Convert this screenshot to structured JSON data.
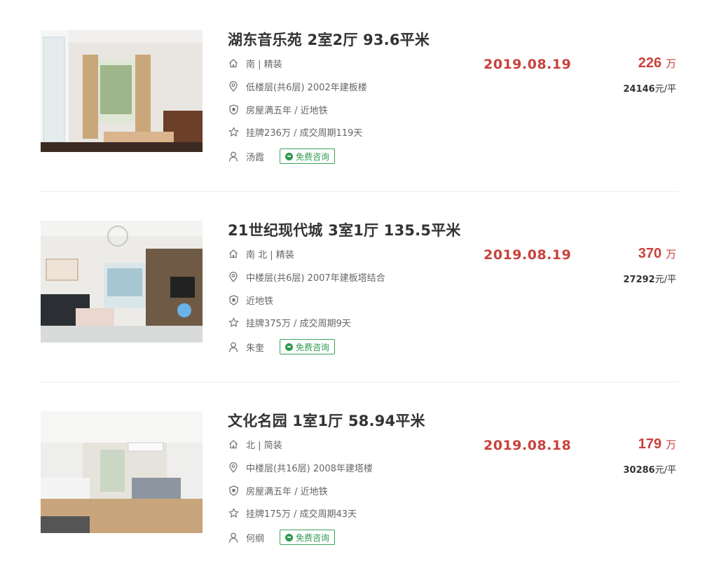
{
  "listings": [
    {
      "title": "湖东音乐苑 2室2厅 93.6平米",
      "orientation": "南 | 精装",
      "floor": "低楼层(共6层) 2002年建板楼",
      "tags": "房屋满五年 / 近地铁",
      "listing_info": "挂牌236万 / 成交周期119天",
      "agent": "汤霞",
      "chat_label": "免费咨询",
      "deal_date": "2019.08.19",
      "total_price": "226",
      "price_unit": "万",
      "unit_price": "24146",
      "unit_price_suffix": "元/平"
    },
    {
      "title": "21世纪现代城 3室1厅 135.5平米",
      "orientation": "南 北 | 精装",
      "floor": "中楼层(共6层) 2007年建板塔结合",
      "tags": "近地铁",
      "listing_info": "挂牌375万 / 成交周期9天",
      "agent": "朱奎",
      "chat_label": "免费咨询",
      "deal_date": "2019.08.19",
      "total_price": "370",
      "price_unit": "万",
      "unit_price": "27292",
      "unit_price_suffix": "元/平"
    },
    {
      "title": "文化名园 1室1厅 58.94平米",
      "orientation": "北 | 简装",
      "floor": "中楼层(共16层) 2008年建塔楼",
      "tags": "房屋满五年 / 近地铁",
      "listing_info": "挂牌175万 / 成交周期43天",
      "agent": "何纲",
      "chat_label": "免费咨询",
      "deal_date": "2019.08.18",
      "total_price": "179",
      "price_unit": "万",
      "unit_price": "30286",
      "unit_price_suffix": "元/平"
    }
  ],
  "icons": {
    "orientation": "house-icon",
    "floor": "location-pin-icon",
    "tags": "shield-icon",
    "listing_info": "star-icon",
    "agent": "user-icon",
    "chat": "chat-bubble-icon"
  },
  "colors": {
    "price_red": "#c9413c",
    "chat_green": "#2f9a4e",
    "title": "#333333"
  }
}
